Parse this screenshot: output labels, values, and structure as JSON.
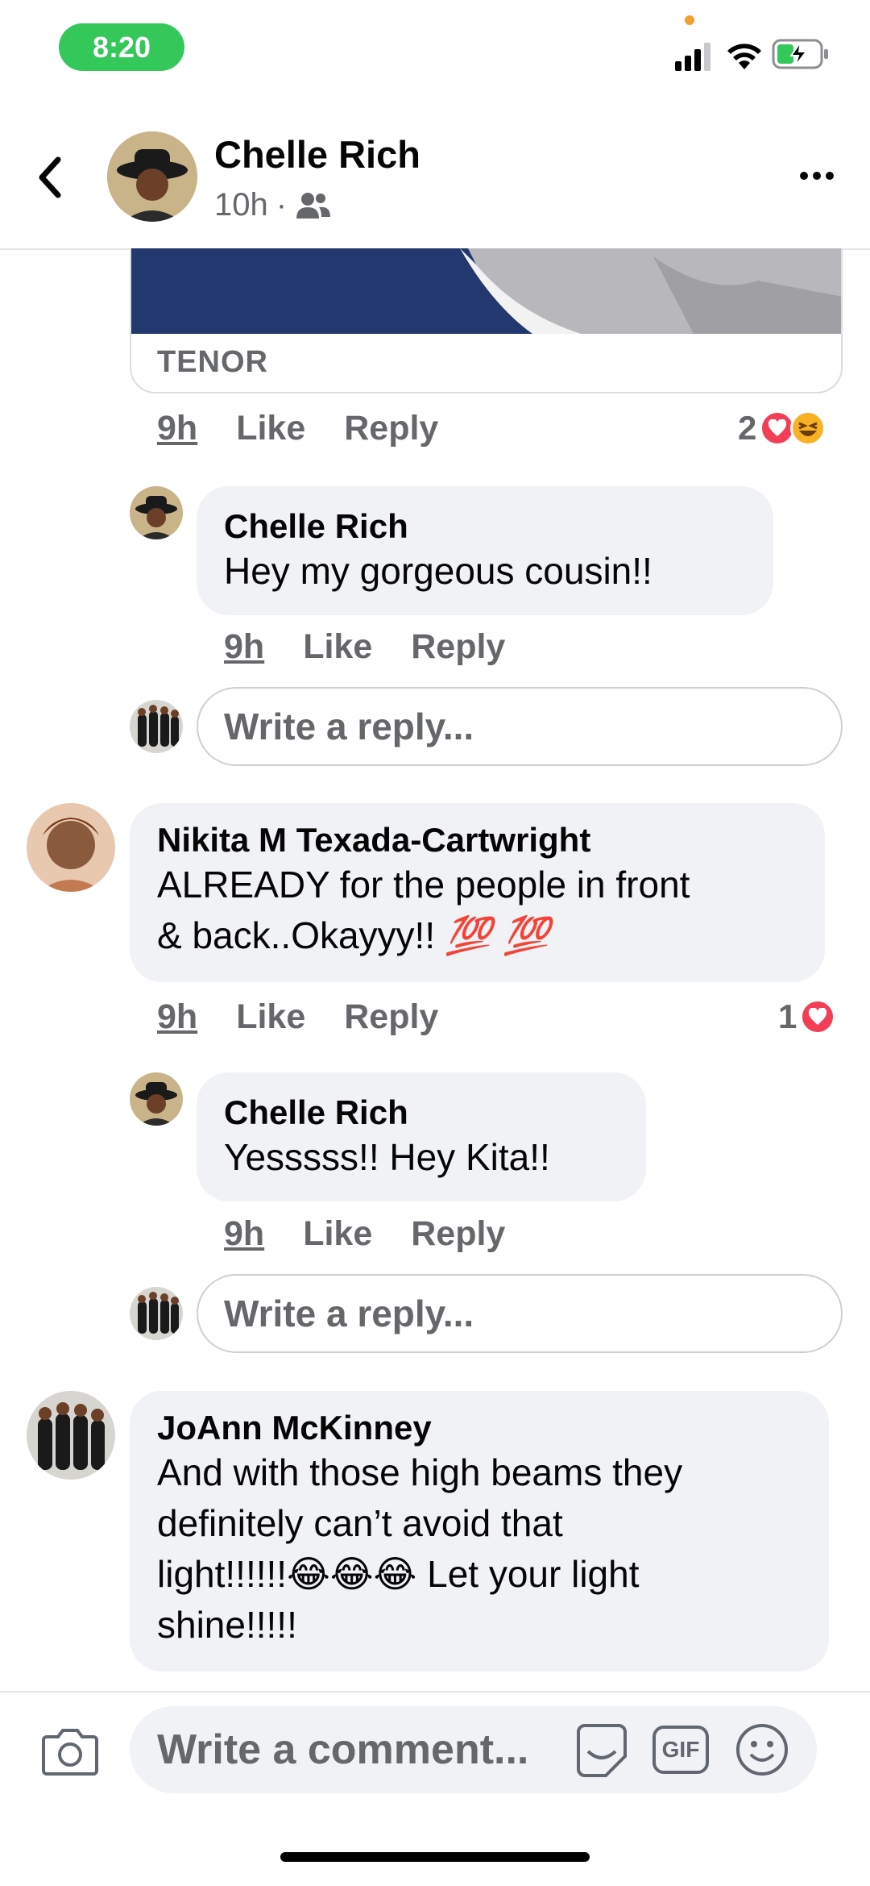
{
  "status_bar": {
    "time": "8:20"
  },
  "header": {
    "name": "Chelle Rich",
    "time": "10h",
    "separator": "·"
  },
  "gif": {
    "provider": "TENOR"
  },
  "actions": {
    "like": "Like",
    "reply": "Reply"
  },
  "comments": [
    {
      "time": "9h",
      "reaction_count": "2",
      "reactions": [
        "love-icon",
        "haha-icon"
      ],
      "replies": [
        {
          "name": "Chelle Rich",
          "text": "Hey my gorgeous cousin!!",
          "time": "9h"
        }
      ]
    },
    {
      "name": "Nikita M Texada-Cartwright",
      "text_line1": "ALREADY for the people in front",
      "text_line2": "& back..Okayyy!!",
      "emoji": "💯 💯",
      "time": "9h",
      "reaction_count": "1",
      "reactions": [
        "love-icon"
      ],
      "replies": [
        {
          "name": "Chelle Rich",
          "text": "Yesssss!! Hey Kita!!",
          "time": "9h"
        }
      ]
    },
    {
      "name": "JoAnn McKinney",
      "text_line1": "And with those high beams they",
      "text_line2": "definitely can’t avoid that",
      "text_line3a": "light!!!!!!",
      "emoji": "😂😂😂",
      "text_line3b": " Let your light",
      "text_line4": "shine!!!!!"
    }
  ],
  "reply_placeholder": "Write a reply...",
  "composer": {
    "placeholder": "Write a comment...",
    "gif_label": "GIF"
  },
  "colors": {
    "love": "#f33e58",
    "haha": "#f7b125",
    "status_green": "#34c759"
  }
}
